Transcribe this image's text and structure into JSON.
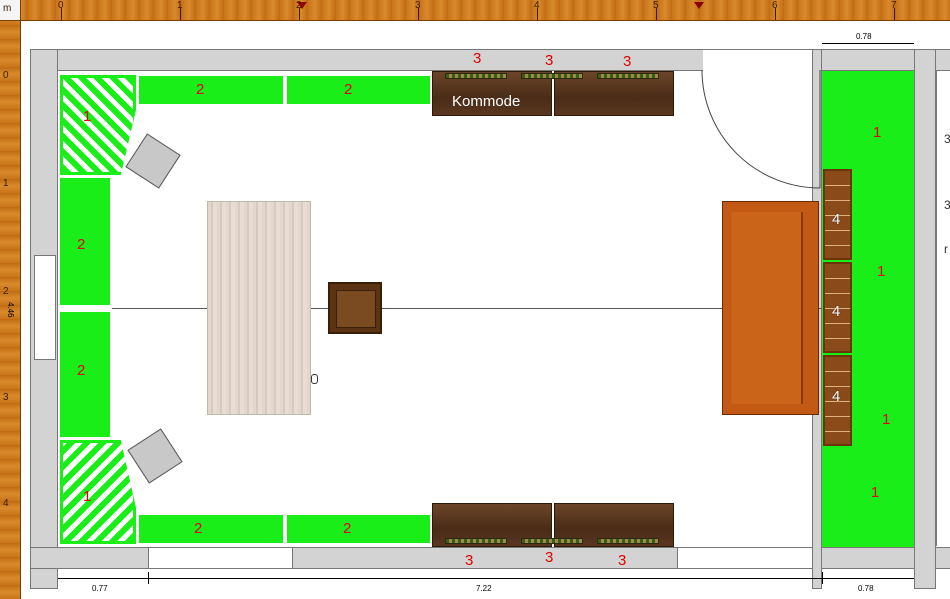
{
  "ruler": {
    "corner": "m",
    "top_ticks": [
      "0",
      "1",
      "2",
      "3",
      "4",
      "5",
      "6",
      "7"
    ],
    "left_ticks": [
      "0",
      "1",
      "2",
      "3",
      "4"
    ]
  },
  "dimensions": {
    "right_top": "0.78",
    "bottom_left": "0.77",
    "bottom_mid": "7.22",
    "bottom_right": "0.78",
    "left_height": "4.46"
  },
  "furniture": {
    "kommode_label": "Kommode",
    "n1": "1",
    "n2": "2",
    "n3": "3",
    "n4": "4"
  },
  "right_edge_text": [
    "3",
    "3",
    "r"
  ],
  "colors": {
    "green": "#19ee19",
    "wood_dark": "#5a3620",
    "sofa": "#c25a16",
    "ruler": "#c8741a",
    "label_red": "#e00000"
  }
}
